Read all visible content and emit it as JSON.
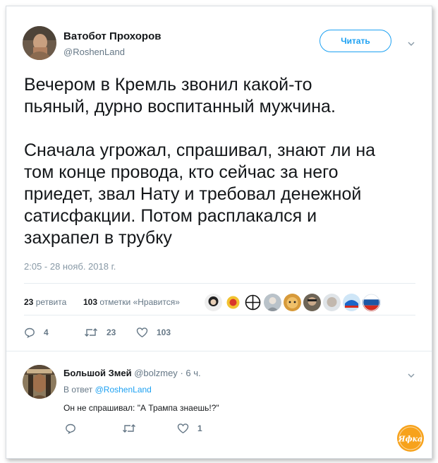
{
  "tweet": {
    "author_name": "Ватобот Прохоров",
    "author_handle": "@RoshenLand",
    "follow_label": "Читать",
    "text_lines": [
      "Вечером в Кремль звонил какой-то",
      "пьяный, дурно воспитанный мужчина.",
      "Сначала угрожал, спрашивал, знают ли на",
      "том конце провода, кто сейчас за него",
      "приедет, звал Нату и требовал денежной",
      "сатисфакции. Потом расплакался и",
      "захрапел в трубку"
    ],
    "timestamp": "2:05 - 28 нояб. 2018 г.",
    "retweets_count": "23",
    "retweets_label": "ретвита",
    "likes_count": "103",
    "likes_label": "отметки «Нравится»",
    "actions": {
      "reply_count": "4",
      "retweet_count": "23",
      "like_count": "103"
    }
  },
  "reply": {
    "author_name": "Большой Змей",
    "author_handle": "@bolzmey",
    "time": "· 6 ч.",
    "reply_to_prefix": "В ответ",
    "reply_to_handle": "@RoshenLand",
    "text": "Он не спрашивал: \"А Трампа знаешь!?\"",
    "like_count": "1"
  },
  "watermark": {
    "text": "Яфка"
  },
  "colors": {
    "accent": "#1da1f2",
    "text": "#14171a",
    "muted": "#657786",
    "divider": "#e6ecf0",
    "watermark": "#f7a21b"
  }
}
